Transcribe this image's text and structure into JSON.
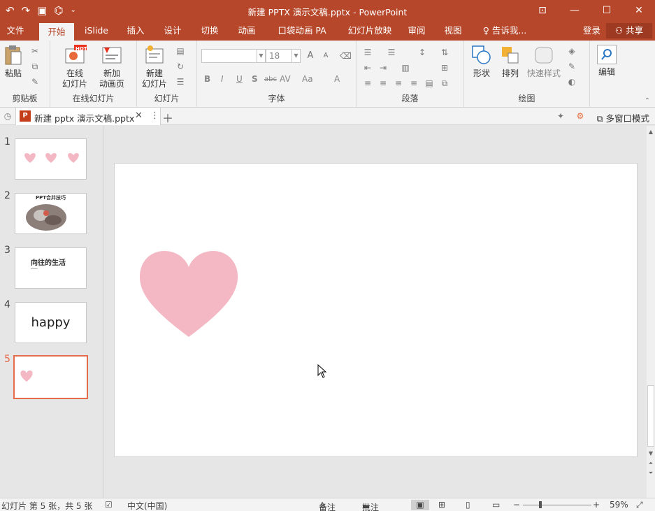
{
  "app": {
    "title": "新建 PPTX 演示文稿.pptx - PowerPoint"
  },
  "tabs": [
    {
      "label": "文件",
      "active": false
    },
    {
      "label": "开始",
      "active": true
    },
    {
      "label": "iSlide",
      "active": false
    },
    {
      "label": "插入",
      "active": false
    },
    {
      "label": "设计",
      "active": false
    },
    {
      "label": "切换",
      "active": false
    },
    {
      "label": "动画",
      "active": false
    },
    {
      "label": "口袋动画 PA",
      "active": false
    },
    {
      "label": "幻灯片放映",
      "active": false
    },
    {
      "label": "审阅",
      "active": false
    },
    {
      "label": "视图",
      "active": false
    }
  ],
  "tell_me": "告诉我...",
  "login": "登录",
  "share": "共享",
  "ribbon": {
    "clipboard": {
      "label": "剪贴板",
      "paste": "粘贴"
    },
    "online_slides": {
      "label": "在线幻灯片",
      "online_slide_l1": "在线",
      "online_slide_l2": "幻灯片",
      "hot": "HOT",
      "new_anim_l1": "新加",
      "new_anim_l2": "动画页"
    },
    "slides": {
      "label": "幻灯片",
      "new_slide_l1": "新建",
      "new_slide_l2": "幻灯片"
    },
    "font": {
      "label": "字体",
      "font_size": "18",
      "font_name": "",
      "bold": "B",
      "italic": "I",
      "underline": "U",
      "shadow": "S",
      "strike": "abc",
      "spacing": "AV",
      "case": "Aa",
      "color": "A",
      "grow": "A",
      "shrink": "A"
    },
    "paragraph": {
      "label": "段落"
    },
    "drawing": {
      "label": "绘图",
      "shapes": "形状",
      "arrange": "排列",
      "quick_styles": "快速样式"
    },
    "editing": {
      "label": "编辑"
    }
  },
  "doc_tab": {
    "name": "新建 pptx 演示文稿.pptx",
    "multi_window": "多窗口模式"
  },
  "thumbnails": [
    {
      "num": "1",
      "text": ""
    },
    {
      "num": "2",
      "text": "PPT合并技巧"
    },
    {
      "num": "3",
      "text": "向往的生活",
      "sub": "━━━━"
    },
    {
      "num": "4",
      "text": "happy"
    },
    {
      "num": "5",
      "text": ""
    }
  ],
  "status": {
    "slide_info": "幻灯片 第 5 张，共 5 张",
    "language": "中文(中国)",
    "notes": "备注",
    "comments": "批注",
    "zoom": "59%"
  },
  "colors": {
    "accent": "#b7472a",
    "heart": "#f4b8c4",
    "selected_border": "#e46c4a"
  }
}
